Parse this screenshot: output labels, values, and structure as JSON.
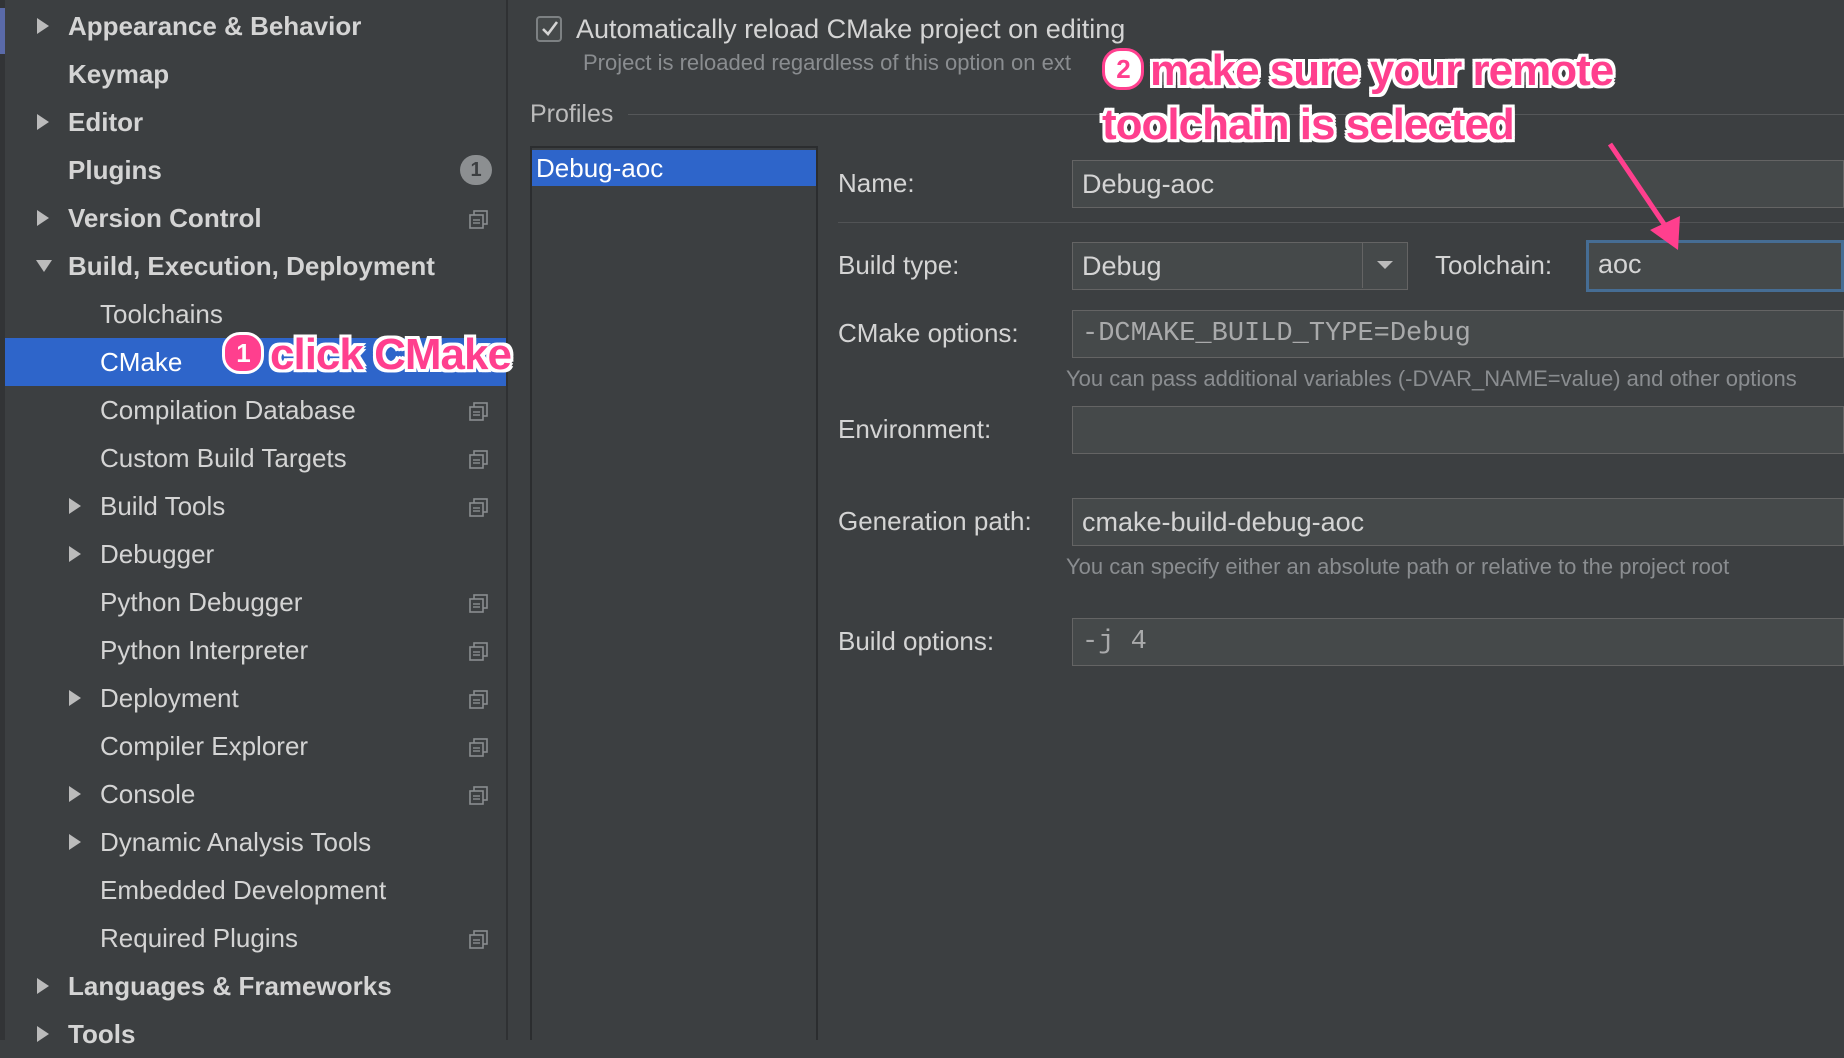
{
  "sidebar": {
    "items": [
      {
        "label": "Appearance & Behavior",
        "bold": true,
        "arrow": "right",
        "level": 0
      },
      {
        "label": "Keymap",
        "bold": true,
        "level": 0
      },
      {
        "label": "Editor",
        "bold": true,
        "arrow": "right",
        "level": 0
      },
      {
        "label": "Plugins",
        "bold": true,
        "level": 0,
        "badge": "1"
      },
      {
        "label": "Version Control",
        "bold": true,
        "arrow": "right",
        "level": 0,
        "copy": true
      },
      {
        "label": "Build, Execution, Deployment",
        "bold": true,
        "arrow": "down",
        "level": 0
      },
      {
        "label": "Toolchains",
        "level": 1
      },
      {
        "label": "CMake",
        "level": 1,
        "selected": true
      },
      {
        "label": "Compilation Database",
        "level": 1,
        "copy": true
      },
      {
        "label": "Custom Build Targets",
        "level": 1,
        "copy": true
      },
      {
        "label": "Build Tools",
        "level": 1,
        "arrow": "right",
        "copy": true
      },
      {
        "label": "Debugger",
        "level": 1,
        "arrow": "right"
      },
      {
        "label": "Python Debugger",
        "level": 1,
        "copy": true
      },
      {
        "label": "Python Interpreter",
        "level": 1,
        "copy": true
      },
      {
        "label": "Deployment",
        "level": 1,
        "arrow": "right",
        "copy": true
      },
      {
        "label": "Compiler Explorer",
        "level": 1,
        "copy": true
      },
      {
        "label": "Console",
        "level": 1,
        "arrow": "right",
        "copy": true
      },
      {
        "label": "Dynamic Analysis Tools",
        "level": 1,
        "arrow": "right"
      },
      {
        "label": "Embedded Development",
        "level": 1
      },
      {
        "label": "Required Plugins",
        "level": 1,
        "copy": true
      },
      {
        "label": "Languages & Frameworks",
        "bold": true,
        "arrow": "right",
        "level": 0
      },
      {
        "label": "Tools",
        "bold": true,
        "arrow": "right",
        "level": 0
      }
    ]
  },
  "main": {
    "auto_reload": {
      "label": "Automatically reload CMake project on editing",
      "checked": true
    },
    "auto_reload_hint": "Project is reloaded regardless of this option on ext",
    "profiles_title": "Profiles",
    "profiles": [
      "Debug-aoc"
    ],
    "form": {
      "name_label": "Name:",
      "name_value": "Debug-aoc",
      "build_type_label": "Build type:",
      "build_type_value": "Debug",
      "toolchain_label": "Toolchain:",
      "toolchain_value": "aoc",
      "cmake_options_label": "CMake options:",
      "cmake_options_value": "-DCMAKE_BUILD_TYPE=Debug",
      "cmake_options_hint": "You can pass additional variables (-DVAR_NAME=value) and other options",
      "environment_label": "Environment:",
      "environment_value": "",
      "generation_path_label": "Generation path:",
      "generation_path_value": "cmake-build-debug-aoc",
      "generation_path_hint": "You can specify either an absolute path or relative to the project root",
      "build_options_label": "Build options:",
      "build_options_value": "-j 4"
    }
  },
  "annotations": {
    "step1_number": "1",
    "step1_text": "click CMake",
    "step2_number": "2",
    "step2_line1": "make sure your remote",
    "step2_line2": "toolchain is selected"
  },
  "colors": {
    "background": "#3c3f41",
    "selection": "#2e65ca",
    "annotation": "#ff3f8e",
    "focus_border": "#466d94"
  }
}
